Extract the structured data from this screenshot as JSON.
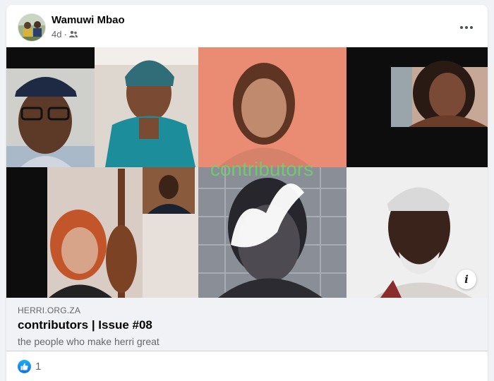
{
  "post": {
    "author": "Wamuwi Mbao",
    "time": "4d",
    "separator": "·",
    "audience_icon": "friends-icon",
    "more_icon": "more-options-icon"
  },
  "collage": {
    "overlay_text": "contributors",
    "overlay_color": "#6fd16b",
    "info_label": "i"
  },
  "link_preview": {
    "domain": "HERRI.ORG.ZA",
    "title": "contributors | Issue #08",
    "description": "the people who make herri great"
  },
  "reactions": {
    "icon": "like-reaction-icon",
    "count": "1",
    "accent": "#1877f2"
  }
}
